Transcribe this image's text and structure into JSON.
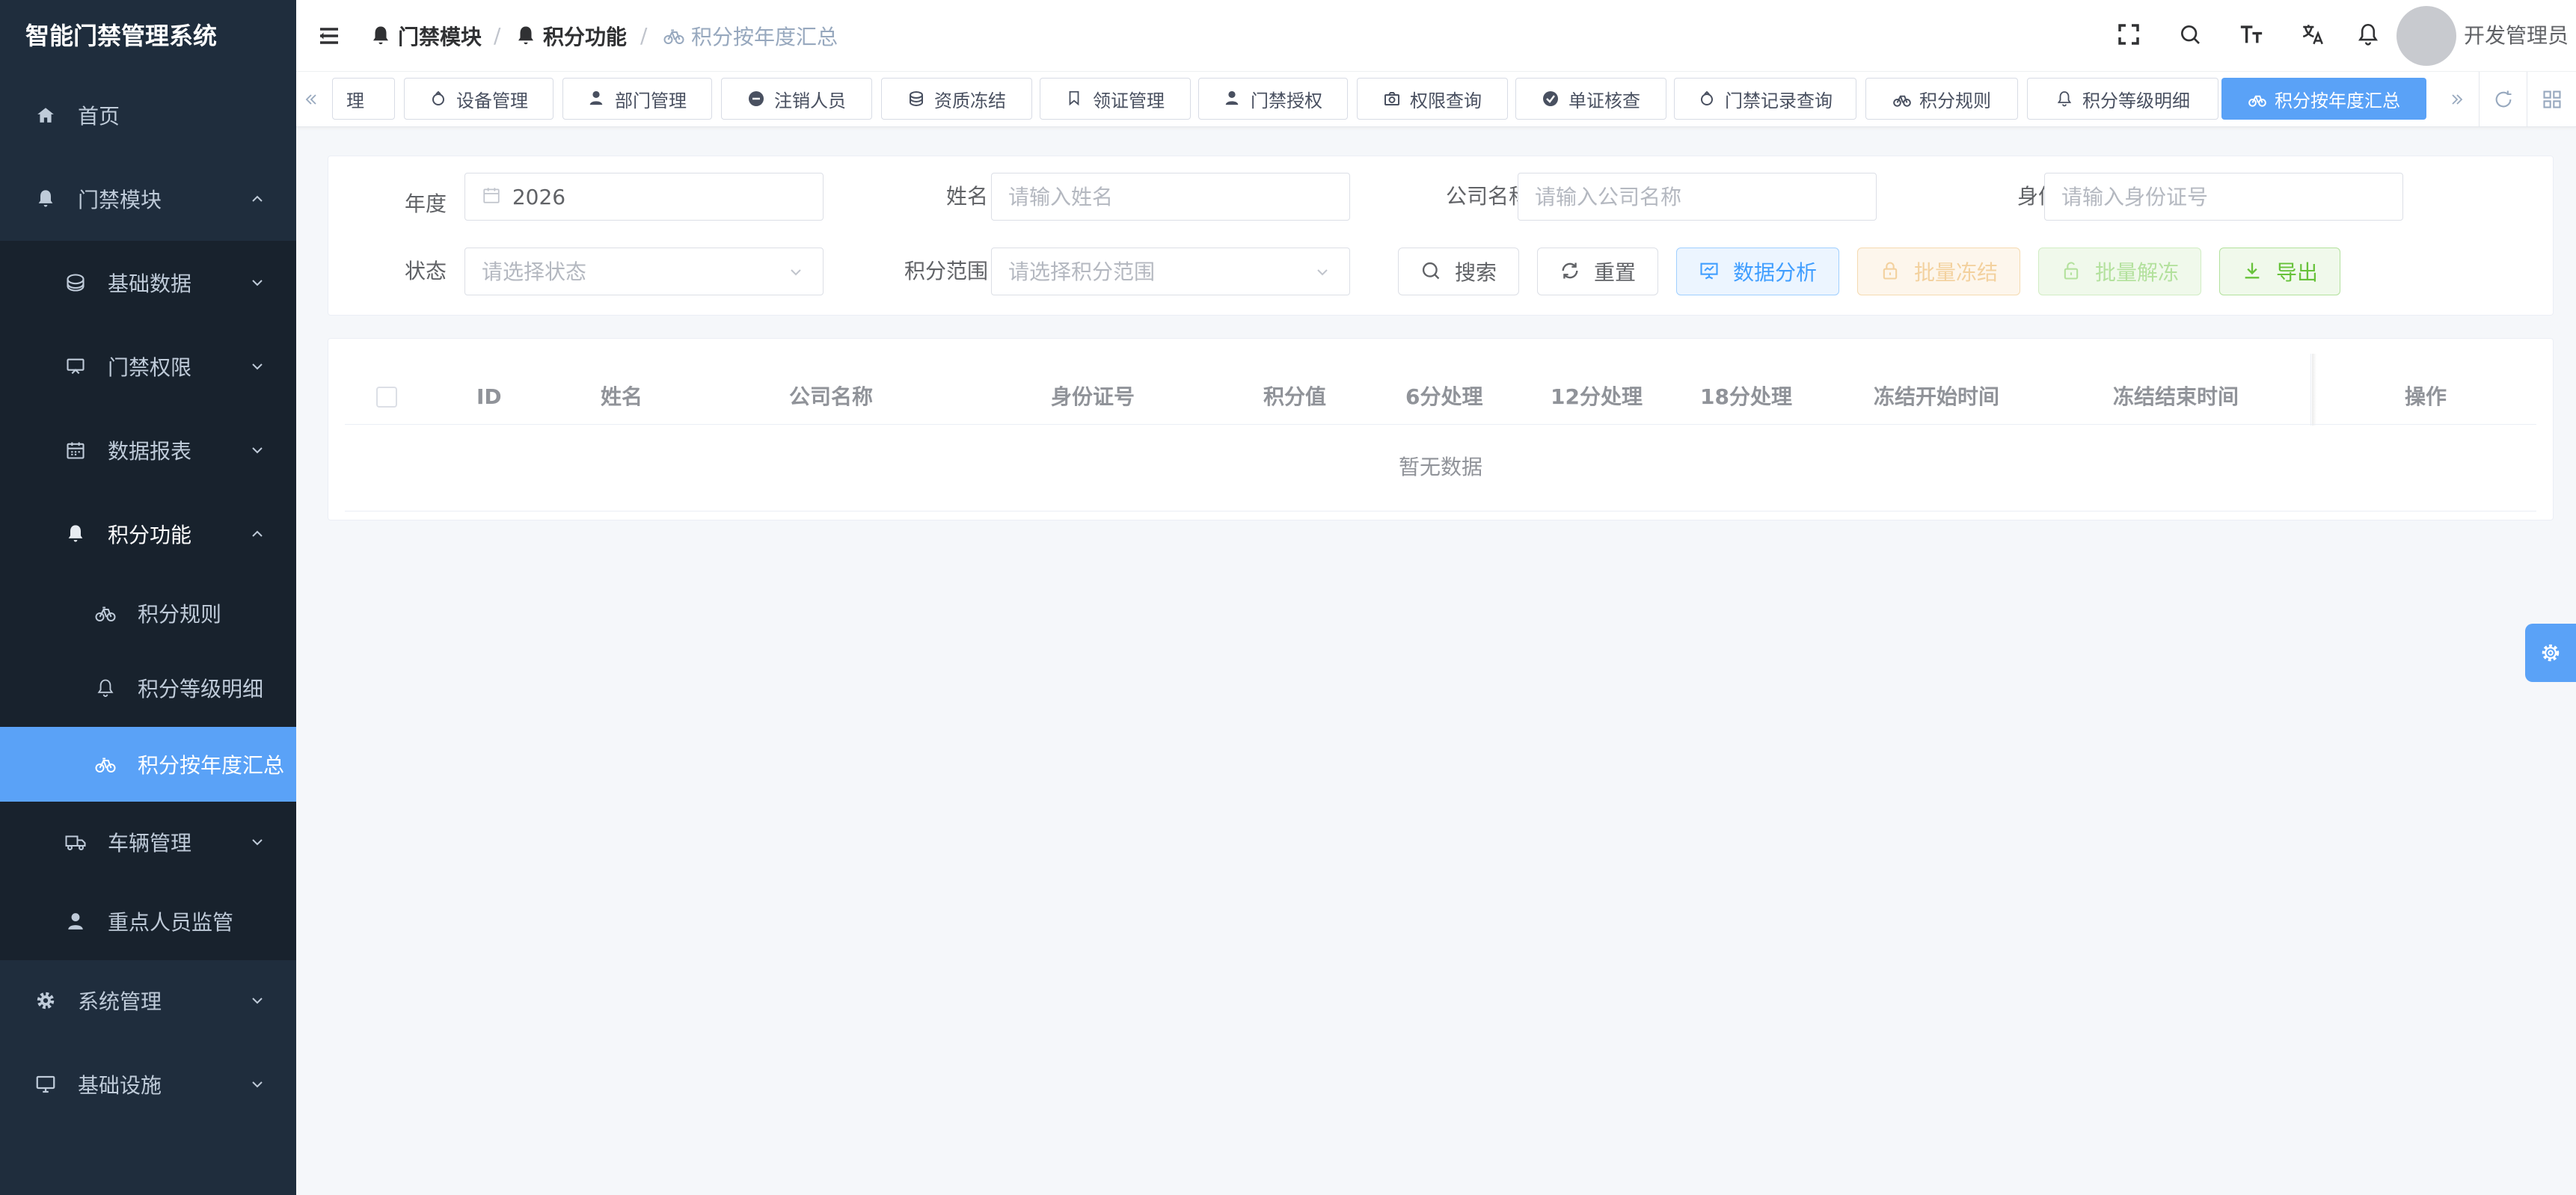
{
  "app": {
    "title": "智能门禁管理系统"
  },
  "sidebar": {
    "home": "首页",
    "access_module": "门禁模块",
    "basic_data": "基础数据",
    "access_rights": "门禁权限",
    "data_report": "数据报表",
    "points_function": "积分功能",
    "points_rules": "积分规则",
    "points_level_detail": "积分等级明细",
    "points_annual_summary": "积分按年度汇总",
    "vehicle_management": "车辆管理",
    "key_personnel": "重点人员监管",
    "system_management": "系统管理",
    "infrastructure": "基础设施"
  },
  "breadcrumb": {
    "level1": "门禁模块",
    "level2": "积分功能",
    "level3": "积分按年度汇总",
    "separator": "/"
  },
  "header": {
    "username": "开发管理员"
  },
  "tags": [
    {
      "label": "理"
    },
    {
      "label": "设备管理"
    },
    {
      "label": "部门管理"
    },
    {
      "label": "注销人员"
    },
    {
      "label": "资质冻结"
    },
    {
      "label": "领证管理"
    },
    {
      "label": "门禁授权"
    },
    {
      "label": "权限查询"
    },
    {
      "label": "单证核查"
    },
    {
      "label": "门禁记录查询"
    },
    {
      "label": "积分规则"
    },
    {
      "label": "积分等级明细"
    },
    {
      "label": "积分按年度汇总"
    }
  ],
  "search": {
    "year_label": "年度",
    "year_value": "2026",
    "name_label": "姓名",
    "name_placeholder": "请输入姓名",
    "company_label": "公司名称",
    "company_placeholder": "请输入公司名称",
    "idcard_label": "身份证号",
    "idcard_placeholder": "请输入身份证号",
    "status_label": "状态",
    "status_placeholder": "请选择状态",
    "range_label": "积分范围",
    "range_placeholder": "请选择积分范围"
  },
  "buttons": {
    "search": "搜索",
    "reset": "重置",
    "analysis": "数据分析",
    "batch_freeze": "批量冻结",
    "batch_unfreeze": "批量解冻",
    "export": "导出"
  },
  "table": {
    "columns": [
      "ID",
      "姓名",
      "公司名称",
      "身份证号",
      "积分值",
      "6分处理",
      "12分处理",
      "18分处理",
      "冻结开始时间",
      "冻结结束时间",
      "操作"
    ],
    "empty_text": "暂无数据"
  },
  "colors": {
    "sidebar_bg": "#1f2d3d",
    "submenu_bg": "#18222d",
    "accent": "#5aa2f7",
    "primary": "#409eff",
    "success": "#67c23a",
    "warning": "#e6a23c"
  },
  "icons": [
    "hamburger-icon",
    "home-icon",
    "bell-icon",
    "database-icon",
    "monitor-icon",
    "calendar-icon",
    "bicycle-icon",
    "truck-icon",
    "user-icon",
    "gear-icon",
    "fullscreen-icon",
    "search-icon",
    "font-size-icon",
    "translate-icon",
    "refresh-icon",
    "grid-icon",
    "lock-icon",
    "download-icon"
  ]
}
